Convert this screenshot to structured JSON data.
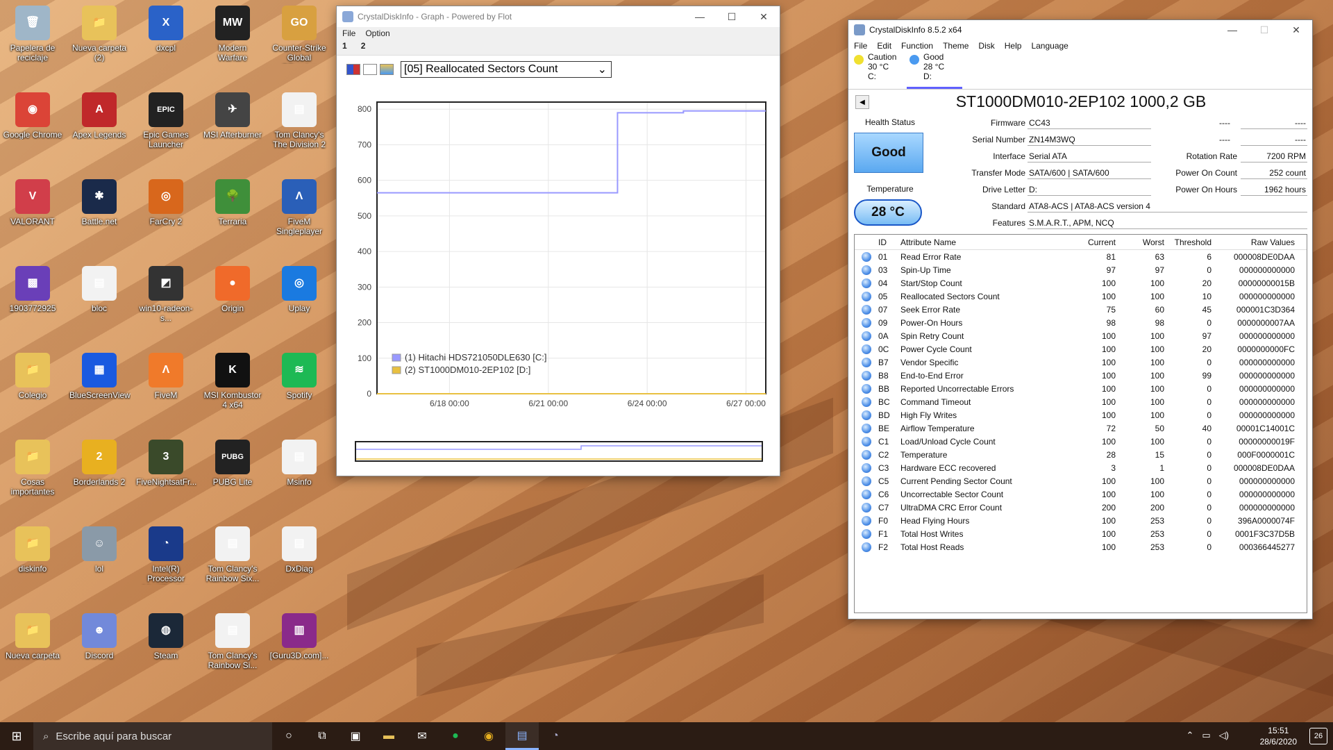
{
  "desktop": {
    "icons": [
      {
        "label": "Papelera de reciclaje",
        "color": "#9fb6c8",
        "glyph": "🗑"
      },
      {
        "label": "Nueva carpeta (2)",
        "color": "#e8c25a",
        "glyph": "📁"
      },
      {
        "label": "dxcpl",
        "color": "#2a62c8",
        "glyph": "X"
      },
      {
        "label": "Modern Warfare",
        "color": "#222",
        "glyph": "MW"
      },
      {
        "label": "Counter-Strike Global Offensive",
        "color": "#d8a040",
        "glyph": "GO"
      },
      {
        "label": "Google Chrome",
        "color": "#db4437",
        "glyph": "◉"
      },
      {
        "label": "Apex Legends",
        "color": "#c0282a",
        "glyph": "A"
      },
      {
        "label": "Epic Games Launcher",
        "color": "#222",
        "glyph": "EPIC"
      },
      {
        "label": "MSI Afterburner",
        "color": "#444",
        "glyph": "✈"
      },
      {
        "label": "Tom Clancy's The Division 2",
        "color": "#f2f2f2",
        "glyph": "▤"
      },
      {
        "label": "VALORANT",
        "color": "#d13e4a",
        "glyph": "V"
      },
      {
        "label": "Battle.net",
        "color": "#1a2a4a",
        "glyph": "✱"
      },
      {
        "label": "FarCry 2",
        "color": "#d8671c",
        "glyph": "◎"
      },
      {
        "label": "Terraria",
        "color": "#3f8f3a",
        "glyph": "🌳"
      },
      {
        "label": "FiveM Singleplayer",
        "color": "#2a5fb8",
        "glyph": "Λ"
      },
      {
        "label": "1903772925",
        "color": "#6a3fb8",
        "glyph": "▩"
      },
      {
        "label": "bloc",
        "color": "#f2f2f2",
        "glyph": "▤"
      },
      {
        "label": "win10-radeon-s...",
        "color": "#333",
        "glyph": "◩"
      },
      {
        "label": "Origin",
        "color": "#f06a2a",
        "glyph": "●"
      },
      {
        "label": "Uplay",
        "color": "#1a7ae0",
        "glyph": "◎"
      },
      {
        "label": "Colegio",
        "color": "#e8c25a",
        "glyph": "📁"
      },
      {
        "label": "BlueScreenView",
        "color": "#1a5ae0",
        "glyph": "▦"
      },
      {
        "label": "FiveM",
        "color": "#f07a2a",
        "glyph": "Λ"
      },
      {
        "label": "MSI Kombustor 4 x64",
        "color": "#111",
        "glyph": "K"
      },
      {
        "label": "Spotify",
        "color": "#1db954",
        "glyph": "≋"
      },
      {
        "label": "Cosas importantes pa...",
        "color": "#e8c25a",
        "glyph": "📁"
      },
      {
        "label": "Borderlands 2",
        "color": "#e8b020",
        "glyph": "2"
      },
      {
        "label": "FiveNightsatFr...",
        "color": "#3a4a2a",
        "glyph": "3"
      },
      {
        "label": "PUBG Lite",
        "color": "#222",
        "glyph": "PUBG"
      },
      {
        "label": "Msinfo",
        "color": "#f2f2f2",
        "glyph": "▤"
      },
      {
        "label": "diskinfo",
        "color": "#e8c25a",
        "glyph": "📁"
      },
      {
        "label": "lol",
        "color": "#8a9aa8",
        "glyph": "☺"
      },
      {
        "label": "Intel(R) Processor Identification U...",
        "color": "#1a3a8a",
        "glyph": "◔"
      },
      {
        "label": "Tom Clancy's Rainbow Six...",
        "color": "#f2f2f2",
        "glyph": "▤"
      },
      {
        "label": "DxDiag",
        "color": "#f2f2f2",
        "glyph": "▤"
      },
      {
        "label": "Nueva carpeta",
        "color": "#e8c25a",
        "glyph": "📁"
      },
      {
        "label": "Discord",
        "color": "#7289da",
        "glyph": "☻"
      },
      {
        "label": "Steam",
        "color": "#1b2838",
        "glyph": "◍"
      },
      {
        "label": "Tom Clancy's Rainbow Si...",
        "color": "#f2f2f2",
        "glyph": "▤"
      },
      {
        "label": "[Guru3D.com]...",
        "color": "#8a2a8a",
        "glyph": "▥"
      }
    ]
  },
  "graph_window": {
    "title": "CrystalDiskInfo - Graph - Powered by Flot",
    "menu": [
      "File",
      "Option"
    ],
    "submenu": [
      "1",
      "2"
    ],
    "selected_attribute": "[05] Reallocated Sectors Count",
    "icons": [
      "flag-icon",
      "window-icon",
      "picture-icon"
    ]
  },
  "chart_data": {
    "type": "line",
    "title": "",
    "xlabel": "",
    "ylabel": "",
    "ylim": [
      0,
      820
    ],
    "yticks": [
      0,
      100,
      200,
      300,
      400,
      500,
      600,
      700,
      800
    ],
    "xtick_labels": [
      "6/18 00:00",
      "6/21 00:00",
      "6/24 00:00",
      "6/27 00:00"
    ],
    "xrange_days": [
      15.8,
      27.6
    ],
    "series": [
      {
        "name": "(1) Hitachi HDS721050DLE630 [C:]",
        "color": "#9999ff",
        "points": [
          [
            15.8,
            565
          ],
          [
            23.1,
            565
          ],
          [
            23.1,
            790
          ],
          [
            25.1,
            790
          ],
          [
            25.1,
            795
          ],
          [
            27.6,
            795
          ]
        ]
      },
      {
        "name": "(2) ST1000DM010-2EP102 [D:]",
        "color": "#e8c040",
        "points": [
          [
            15.8,
            0
          ],
          [
            27.6,
            0
          ]
        ]
      }
    ],
    "legend": "bottom-left",
    "grid": true
  },
  "crystal_window": {
    "title": "CrystalDiskInfo 8.5.2 x64",
    "menu": [
      "File",
      "Edit",
      "Function",
      "Theme",
      "Disk",
      "Help",
      "Language"
    ],
    "drives": [
      {
        "status": "Caution",
        "temp": "30 °C",
        "letter": "C:",
        "color": "#f0e030"
      },
      {
        "status": "Good",
        "temp": "28 °C",
        "letter": "D:",
        "color": "#4a9af0"
      }
    ],
    "model": "ST1000DM010-2EP102 1000,2 GB",
    "health_label": "Health Status",
    "health_value": "Good",
    "temp_label": "Temperature",
    "temp_value": "28 °C",
    "fields": {
      "firmware_label": "Firmware",
      "firmware": "CC43",
      "serial_label": "Serial Number",
      "serial": "ZN14M3WQ",
      "interface_label": "Interface",
      "interface": "Serial ATA",
      "transfer_label": "Transfer Mode",
      "transfer": "SATA/600 | SATA/600",
      "letter_label": "Drive Letter",
      "letter": "D:",
      "standard_label": "Standard",
      "standard": "ATA8-ACS | ATA8-ACS version 4",
      "features_label": "Features",
      "features": "S.M.A.R.T., APM, NCQ",
      "r1a": "----",
      "r1b": "----",
      "r2a": "----",
      "r2b": "----",
      "rotation_label": "Rotation Rate",
      "rotation": "7200 RPM",
      "poweron_count_label": "Power On Count",
      "poweron_count": "252 count",
      "poweron_hours_label": "Power On Hours",
      "poweron_hours": "1962 hours"
    },
    "smart_headers": [
      "ID",
      "Attribute Name",
      "Current",
      "Worst",
      "Threshold",
      "Raw Values"
    ],
    "smart_rows": [
      [
        "01",
        "Read Error Rate",
        "81",
        "63",
        "6",
        "000008DE0DAA"
      ],
      [
        "03",
        "Spin-Up Time",
        "97",
        "97",
        "0",
        "000000000000"
      ],
      [
        "04",
        "Start/Stop Count",
        "100",
        "100",
        "20",
        "00000000015B"
      ],
      [
        "05",
        "Reallocated Sectors Count",
        "100",
        "100",
        "10",
        "000000000000"
      ],
      [
        "07",
        "Seek Error Rate",
        "75",
        "60",
        "45",
        "000001C3D364"
      ],
      [
        "09",
        "Power-On Hours",
        "98",
        "98",
        "0",
        "0000000007AA"
      ],
      [
        "0A",
        "Spin Retry Count",
        "100",
        "100",
        "97",
        "000000000000"
      ],
      [
        "0C",
        "Power Cycle Count",
        "100",
        "100",
        "20",
        "0000000000FC"
      ],
      [
        "B7",
        "Vendor Specific",
        "100",
        "100",
        "0",
        "000000000000"
      ],
      [
        "B8",
        "End-to-End Error",
        "100",
        "100",
        "99",
        "000000000000"
      ],
      [
        "BB",
        "Reported Uncorrectable Errors",
        "100",
        "100",
        "0",
        "000000000000"
      ],
      [
        "BC",
        "Command Timeout",
        "100",
        "100",
        "0",
        "000000000000"
      ],
      [
        "BD",
        "High Fly Writes",
        "100",
        "100",
        "0",
        "000000000000"
      ],
      [
        "BE",
        "Airflow Temperature",
        "72",
        "50",
        "40",
        "00001C14001C"
      ],
      [
        "C1",
        "Load/Unload Cycle Count",
        "100",
        "100",
        "0",
        "00000000019F"
      ],
      [
        "C2",
        "Temperature",
        "28",
        "15",
        "0",
        "000F0000001C"
      ],
      [
        "C3",
        "Hardware ECC recovered",
        "3",
        "1",
        "0",
        "000008DE0DAA"
      ],
      [
        "C5",
        "Current Pending Sector Count",
        "100",
        "100",
        "0",
        "000000000000"
      ],
      [
        "C6",
        "Uncorrectable Sector Count",
        "100",
        "100",
        "0",
        "000000000000"
      ],
      [
        "C7",
        "UltraDMA CRC Error Count",
        "200",
        "200",
        "0",
        "000000000000"
      ],
      [
        "F0",
        "Head Flying Hours",
        "100",
        "253",
        "0",
        "396A0000074F"
      ],
      [
        "F1",
        "Total Host Writes",
        "100",
        "253",
        "0",
        "0001F3C37D5B"
      ],
      [
        "F2",
        "Total Host Reads",
        "100",
        "253",
        "0",
        "000366445277"
      ]
    ]
  },
  "taskbar": {
    "search_placeholder": "Escribe aquí para buscar",
    "time": "15:51",
    "date": "28/6/2020",
    "notifications": "26"
  }
}
